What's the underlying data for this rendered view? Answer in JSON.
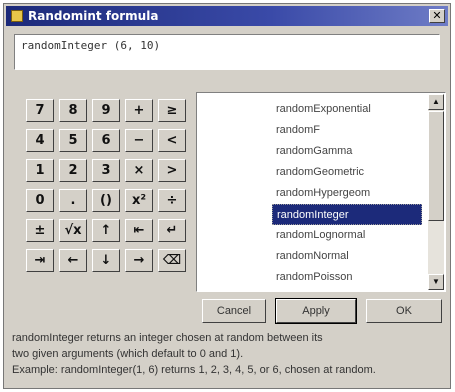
{
  "window": {
    "title": "Randomint formula",
    "close_label": "✕"
  },
  "formula": {
    "text": "randomInteger (6, 10)"
  },
  "keypad": {
    "keys": [
      {
        "label": "7",
        "name": "key-7"
      },
      {
        "label": "8",
        "name": "key-8"
      },
      {
        "label": "9",
        "name": "key-9"
      },
      {
        "label": "+",
        "name": "key-plus"
      },
      {
        "label": "≥",
        "name": "key-greater-equal"
      },
      {
        "label": "4",
        "name": "key-4"
      },
      {
        "label": "5",
        "name": "key-5"
      },
      {
        "label": "6",
        "name": "key-6"
      },
      {
        "label": "−",
        "name": "key-minus"
      },
      {
        "label": "<",
        "name": "key-less-than"
      },
      {
        "label": "1",
        "name": "key-1"
      },
      {
        "label": "2",
        "name": "key-2"
      },
      {
        "label": "3",
        "name": "key-3"
      },
      {
        "label": "×",
        "name": "key-multiply"
      },
      {
        "label": ">",
        "name": "key-greater-than"
      },
      {
        "label": "0",
        "name": "key-0"
      },
      {
        "label": ".",
        "name": "key-decimal"
      },
      {
        "label": "()",
        "name": "key-parentheses"
      },
      {
        "label": "x²",
        "name": "key-square"
      },
      {
        "label": "÷",
        "name": "key-divide"
      },
      {
        "label": "±",
        "name": "key-plus-minus"
      },
      {
        "label": "√x",
        "name": "key-square-root"
      },
      {
        "label": "↑",
        "name": "key-up"
      },
      {
        "label": "⇤",
        "name": "key-home"
      },
      {
        "label": "↵",
        "name": "key-enter"
      },
      {
        "label": "⇥",
        "name": "key-end"
      },
      {
        "label": "←",
        "name": "key-left"
      },
      {
        "label": "↓",
        "name": "key-down"
      },
      {
        "label": "→",
        "name": "key-right"
      },
      {
        "label": "⌫",
        "name": "key-backspace"
      }
    ]
  },
  "functions": {
    "items": [
      "randomExponential",
      "randomF",
      "randomGamma",
      "randomGeometric",
      "randomHypergeom",
      "randomInteger",
      "randomLognormal",
      "randomNormal",
      "randomPoisson"
    ],
    "selected_index": 5
  },
  "buttons": {
    "cancel": "Cancel",
    "apply": "Apply",
    "ok": "OK"
  },
  "description": {
    "line1": "randomInteger returns an integer chosen at random between its",
    "line2": "two given arguments (which default to 0 and 1).",
    "line3": "Example: randomInteger(1, 6) returns 1, 2, 3, 4, 5, or 6, chosen at random."
  }
}
